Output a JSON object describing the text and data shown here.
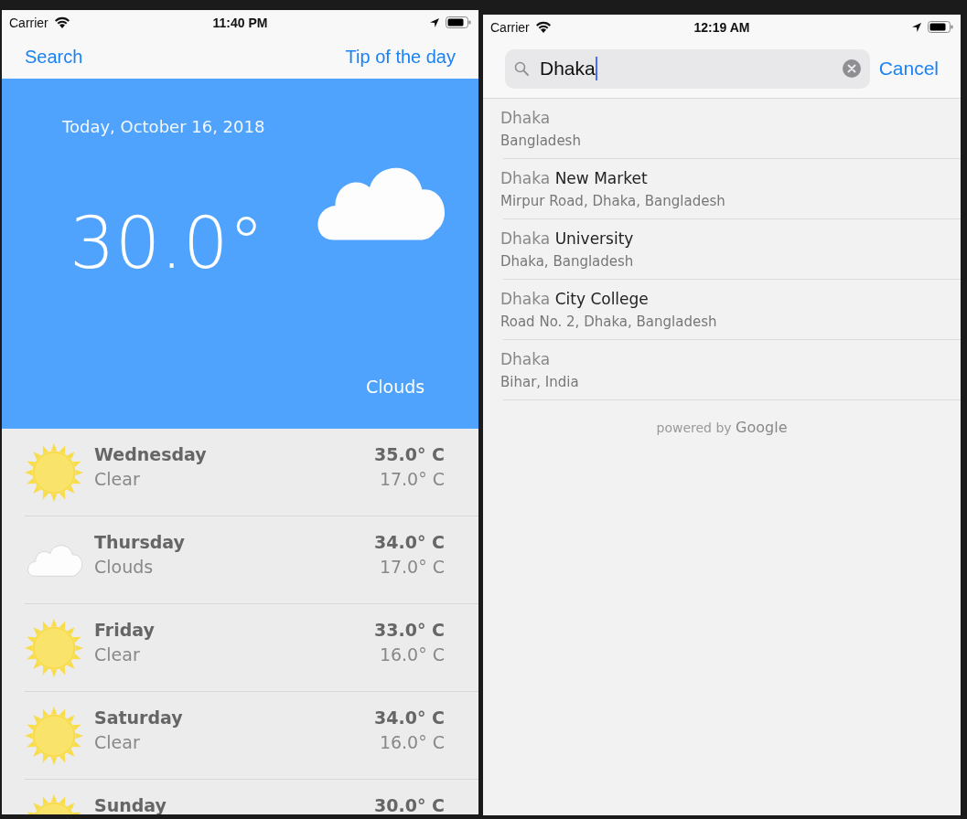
{
  "weather_screen": {
    "status_bar": {
      "carrier": "Carrier",
      "time": "11:40 PM"
    },
    "nav": {
      "left": "Search",
      "right": "Tip of the day"
    },
    "today": {
      "date": "Today, October 16, 2018",
      "temperature": "30.0°",
      "condition": "Clouds",
      "kind": "cloud"
    },
    "forecast": [
      {
        "day": "Wednesday",
        "condition": "Clear",
        "high": "35.0° C",
        "low": "17.0° C",
        "kind": "sun"
      },
      {
        "day": "Thursday",
        "condition": "Clouds",
        "high": "34.0° C",
        "low": "17.0° C",
        "kind": "cloud"
      },
      {
        "day": "Friday",
        "condition": "Clear",
        "high": "33.0° C",
        "low": "16.0° C",
        "kind": "sun"
      },
      {
        "day": "Saturday",
        "condition": "Clear",
        "high": "34.0° C",
        "low": "16.0° C",
        "kind": "sun"
      },
      {
        "day": "Sunday",
        "high": "30.0° C",
        "kind": "sun"
      }
    ]
  },
  "search_screen": {
    "status_bar": {
      "carrier": "Carrier",
      "time": "12:19 AM"
    },
    "search": {
      "value": "Dhaka",
      "cancel": "Cancel"
    },
    "results": [
      {
        "match": "Dhaka",
        "subtitle": "Bangladesh"
      },
      {
        "match": "Dhaka",
        "rest": "New Market",
        "subtitle": "Mirpur Road, Dhaka, Bangladesh"
      },
      {
        "match": "Dhaka",
        "rest": "University",
        "subtitle": "Dhaka, Bangladesh"
      },
      {
        "match": "Dhaka",
        "rest": "City College",
        "subtitle": "Road No. 2, Dhaka, Bangladesh"
      },
      {
        "match": "Dhaka",
        "subtitle": "Bihar, India"
      }
    ],
    "attribution": "powered by **Google**"
  }
}
